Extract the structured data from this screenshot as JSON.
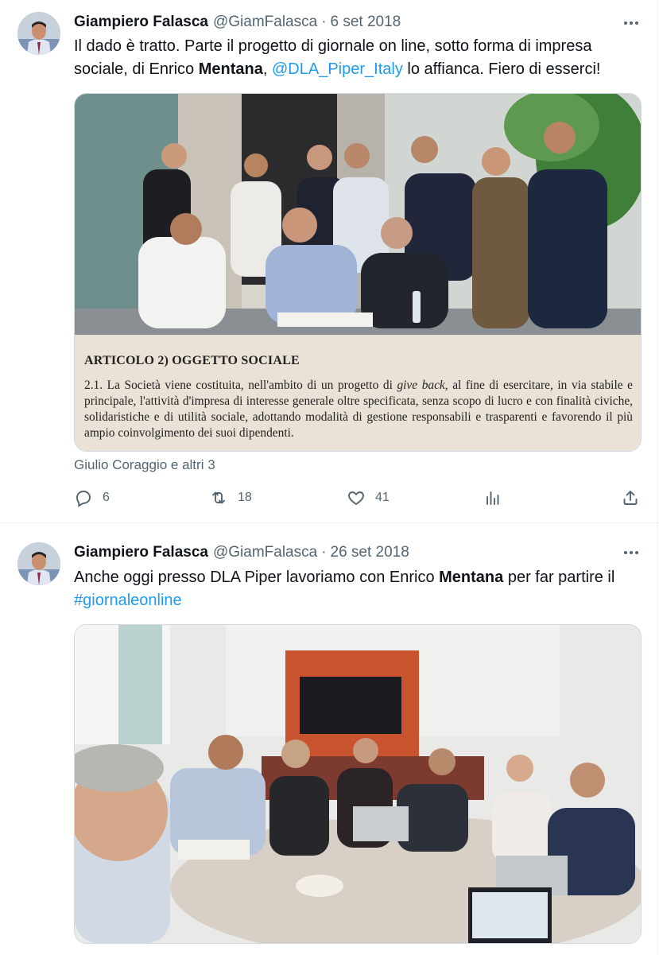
{
  "tweets": [
    {
      "author_name": "Giampiero Falasca",
      "handle": "@GiamFalasca",
      "separator": "·",
      "date": "6 set 2018",
      "text": {
        "p1": "Il dado è tratto. Parte il progetto di giornale on line, sotto forma di impresa sociale, di Enrico ",
        "bold": "Mentana",
        "p2": ", ",
        "mention": "@DLA_Piper_Italy",
        "p3": " lo affianca. Fiero di esserci!"
      },
      "image_text": {
        "heading": "ARTICOLO 2) OGGETTO SOCIALE",
        "body_start": "2.1. La Società viene costituita, nell'ambito di un progetto di ",
        "body_italic": "give back",
        "body_end": ", al fine di esercitare, in via stabile e principale, l'attività d'impresa di interesse generale oltre specificata, senza scopo di lucro e con finalità civiche, solidaristiche e di utilità sociale, adottando modalità di gestione responsabili e trasparenti e favorendo il più ampio coinvolgimento dei suoi dipendenti."
      },
      "liked_by": "Giulio Coraggio e altri 3",
      "actions": {
        "replies": "6",
        "retweets": "18",
        "likes": "41"
      }
    },
    {
      "author_name": "Giampiero Falasca",
      "handle": "@GiamFalasca",
      "separator": "·",
      "date": "26 set 2018",
      "text": {
        "p1": "Anche oggi presso DLA Piper lavoriamo con Enrico ",
        "bold": "Mentana",
        "p2": " per far partire il ",
        "hashtag": "#giornaleonline"
      }
    }
  ],
  "colors": {
    "text_primary": "#0f1419",
    "text_secondary": "#536471",
    "link": "#1d9bf0",
    "border": "#cfd9de"
  },
  "icons": [
    "reply-icon",
    "retweet-icon",
    "like-icon",
    "views-icon",
    "share-icon",
    "more-icon"
  ]
}
